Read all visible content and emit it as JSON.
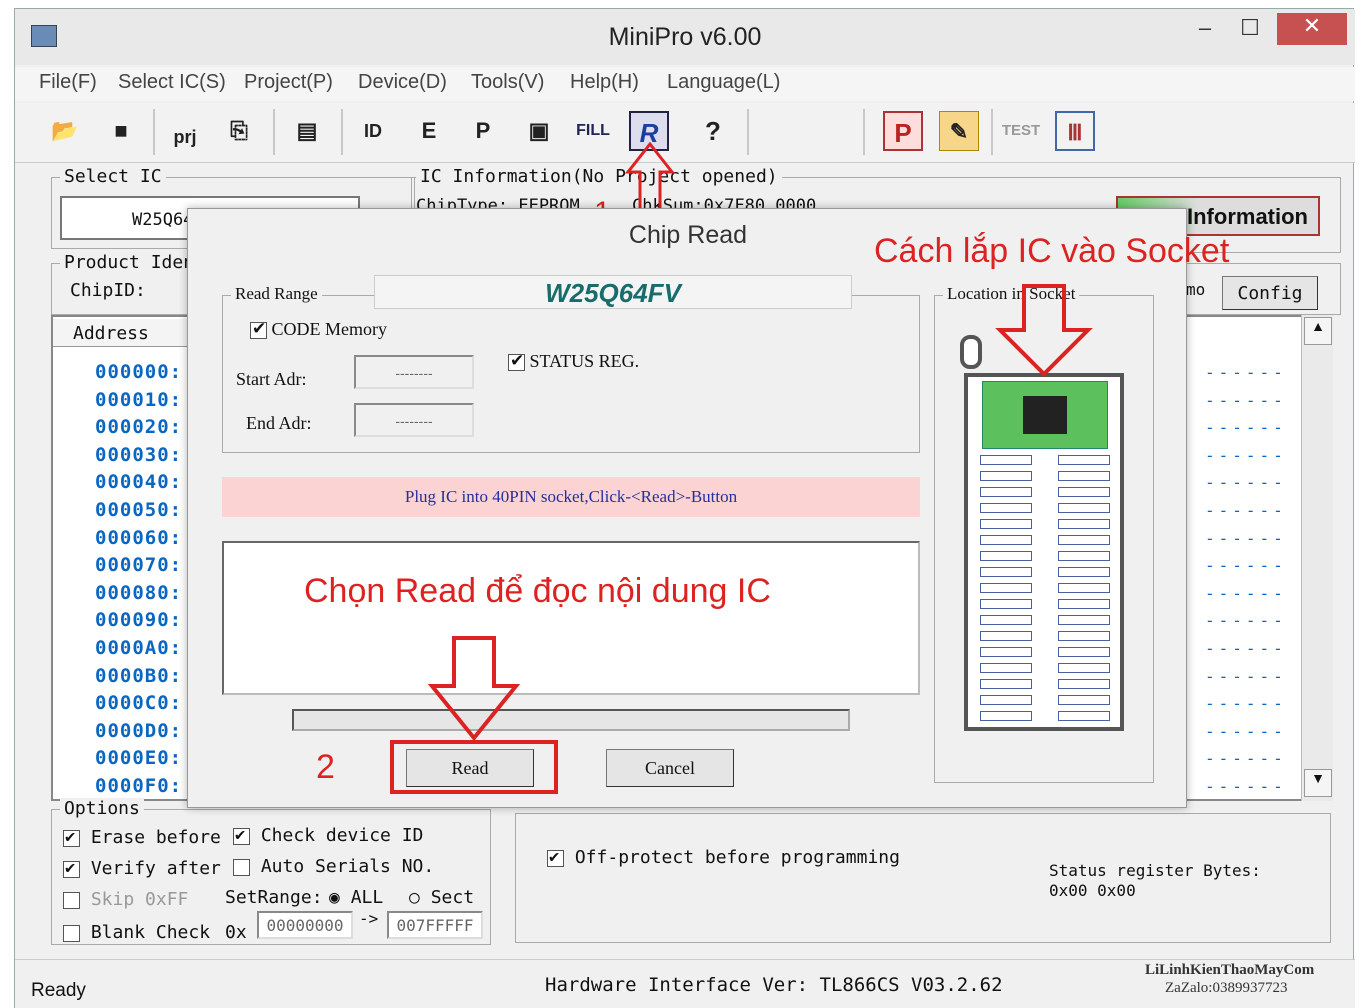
{
  "window": {
    "title": "MiniPro v6.00",
    "min": "–",
    "max": "☐",
    "close": "✕"
  },
  "menu": [
    "File(F)",
    "Select IC(S)",
    "Project(P)",
    "Device(D)",
    "Tools(V)",
    "Help(H)",
    "Language(L)"
  ],
  "toolbar": {
    "prj_label": "prj",
    "fill_label": "FILL",
    "r_label": "R",
    "help": "?",
    "p_label": "P",
    "test_label": "TEST"
  },
  "select_ic": {
    "title": "Select IC",
    "value": "W25Q64"
  },
  "ic_info": {
    "title": "IC Information(No Project opened)",
    "chip_type": "ChipType: EEPROM",
    "checksum": "ChkSum:0x7F80_0000",
    "info_button": "Information"
  },
  "product": {
    "title": "Product Iden",
    "chip_id": "ChipID:",
    "demo": "mo",
    "config": "Config"
  },
  "address_header": "Address",
  "addresses": [
    "000000:",
    "000010:",
    "000020:",
    "000030:",
    "000040:",
    "000050:",
    "000060:",
    "000070:",
    "000080:",
    "000090:",
    "0000A0:",
    "0000B0:",
    "0000C0:",
    "0000D0:",
    "0000E0:",
    "0000F0:"
  ],
  "dots": "------",
  "options": {
    "title": "Options",
    "erase": "Erase before",
    "check_id": "Check device ID",
    "verify": "Verify after",
    "auto_serials": "Auto Serials NO.",
    "skip": "Skip 0xFF",
    "setrange": "SetRange:",
    "all": "ALL",
    "sect": "Sect",
    "blank": "Blank Check",
    "ox": "0x",
    "range_from": "00000000",
    "arrow": "->",
    "range_to": "007FFFFF",
    "off_protect": "Off-protect before programming",
    "status_label": "Status register Bytes:",
    "status_values": "0x00 0x00"
  },
  "status_bar": {
    "ready": "Ready",
    "hw": "Hardware Interface Ver: TL866CS V03.2.62",
    "watermark1": "LiLinhKienThaoMayCom",
    "watermark2": "ZaZalo:0389937723"
  },
  "dialog": {
    "title": "Chip Read",
    "chip": "W25Q64FV",
    "read_range": "Read Range",
    "code_memory": "CODE Memory",
    "status_reg": "STATUS REG.",
    "start_adr": "Start Adr:",
    "end_adr": "End Adr:",
    "start_val": "--------",
    "end_val": "--------",
    "message": "Plug IC into 40PIN socket,Click-<Read>-Button",
    "location": "Location in Socket",
    "read_btn": "Read",
    "cancel_btn": "Cancel"
  },
  "annotations": {
    "num1": "1",
    "num2": "2",
    "socket_note": "Cách lắp IC vào Socket",
    "read_note": "Chọn Read để đọc nội dung IC"
  }
}
